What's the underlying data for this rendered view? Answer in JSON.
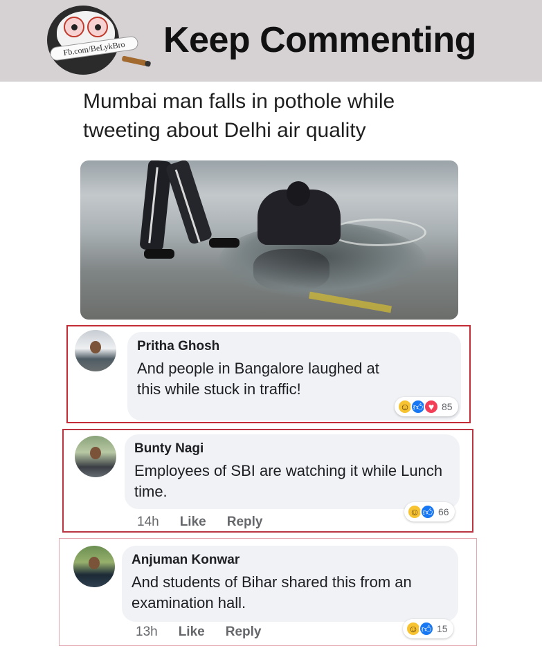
{
  "header": {
    "logo_text": "Fb.com/BeLykBro",
    "title": "Keep Commenting",
    "background": "#d6d1d2"
  },
  "post": {
    "headline": "Mumbai man falls in pothole while tweeting about Delhi air quality"
  },
  "comments": [
    {
      "author": "Pritha Ghosh",
      "text": "And people in Bangalore laughed at this while stuck in traffic!",
      "reactions": [
        "haha",
        "like",
        "love"
      ],
      "reaction_count": "85",
      "border_color": "#c32b36"
    },
    {
      "author": "Bunty Nagi",
      "text": "Employees of SBI are watching it while Lunch time.",
      "time": "14h",
      "like_label": "Like",
      "reply_label": "Reply",
      "reactions": [
        "haha",
        "like"
      ],
      "reaction_count": "66",
      "border_color": "#b93542"
    },
    {
      "author": "Anjuman Konwar",
      "text": "And students of Bihar shared this from an examination hall.",
      "time": "13h",
      "like_label": "Like",
      "reply_label": "Reply",
      "reactions": [
        "haha",
        "like"
      ],
      "reaction_count": "15",
      "border_color": "#e3a9b2"
    }
  ],
  "icons": {
    "haha": "laughing-face-icon",
    "like": "thumbs-up-icon",
    "love": "heart-icon"
  }
}
